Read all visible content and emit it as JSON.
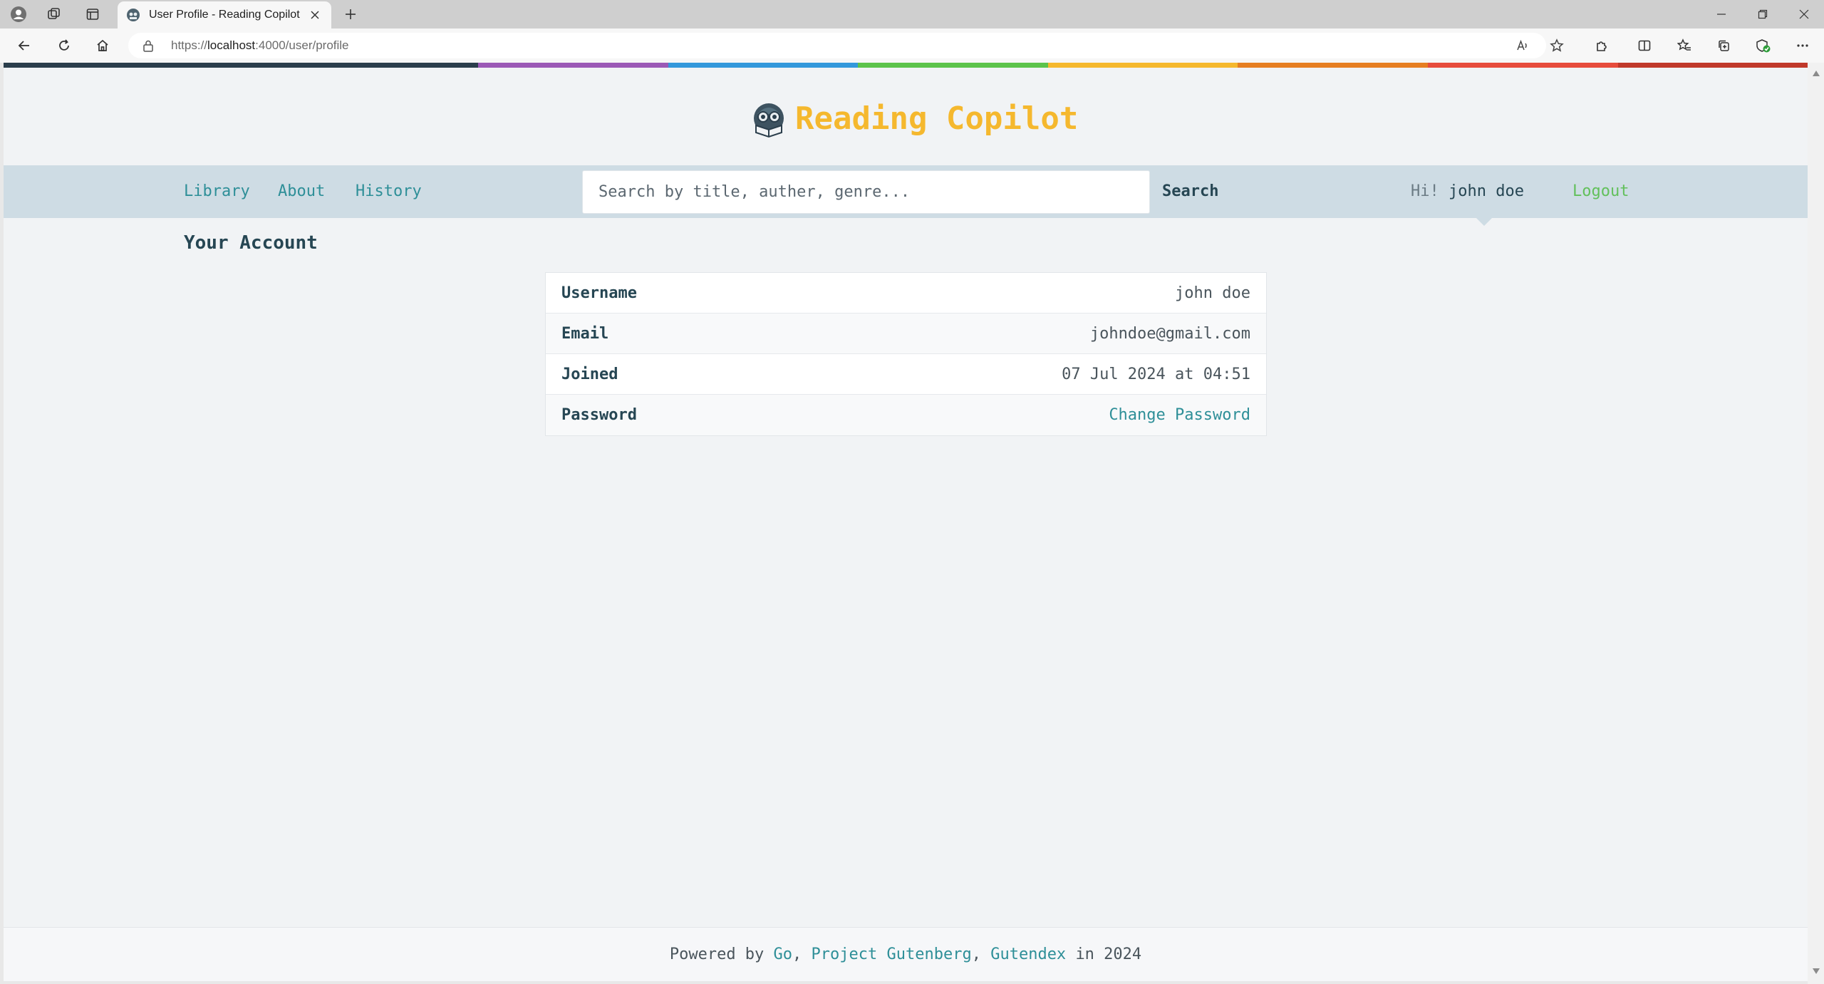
{
  "browser": {
    "tab_title": "User Profile - Reading Copilot",
    "url_prefix": "https://",
    "url_host": "localhost",
    "url_path": ":4000/user/profile",
    "icons": [
      "profile-icon",
      "workspaces-icon",
      "tab-actions-icon",
      "new-tab-icon",
      "minimize-icon",
      "restore-icon",
      "close-icon",
      "back-icon",
      "refresh-icon",
      "home-icon",
      "lock-icon",
      "read-aloud-icon",
      "favorite-star-icon",
      "extensions-icon",
      "split-screen-icon",
      "favorites-icon",
      "collections-icon",
      "browser-essentials-icon",
      "more-icon"
    ]
  },
  "colors": {
    "brand_yellow": "#f5b82e",
    "link_teal": "#2e8f98",
    "dark_slate": "#264653",
    "logout_green": "#62c05b",
    "navbar_bg": "#cedce4",
    "page_bg": "#f1f3f5",
    "rainbow": [
      "#2b3e4c",
      "#9b59b6",
      "#3498db",
      "#5cc34b",
      "#f5b82e",
      "#e67e22",
      "#e74c3c",
      "#c0392b"
    ]
  },
  "header": {
    "brand": "Reading Copilot",
    "logo": "reading-robot-logo"
  },
  "nav": {
    "links": [
      "Library",
      "About",
      "History"
    ],
    "search_placeholder": "Search by title, auther, genre...",
    "search_label": "Search",
    "greeting_prefix": "Hi!",
    "username": "john doe",
    "logout_label": "Logout"
  },
  "account": {
    "heading": "Your Account",
    "rows": [
      {
        "label": "Username",
        "value": "john doe"
      },
      {
        "label": "Email",
        "value": "johndoe@gmail.com"
      },
      {
        "label": "Joined",
        "value": "07 Jul 2024 at 04:51"
      },
      {
        "label": "Password",
        "value": "Change Password"
      }
    ]
  },
  "footer": {
    "prefix": "Powered by",
    "link1": "Go",
    "sep1": ",",
    "link2": "Project Gutenberg",
    "sep2": ",",
    "link3": "Gutendex",
    "suffix": "in 2024"
  }
}
